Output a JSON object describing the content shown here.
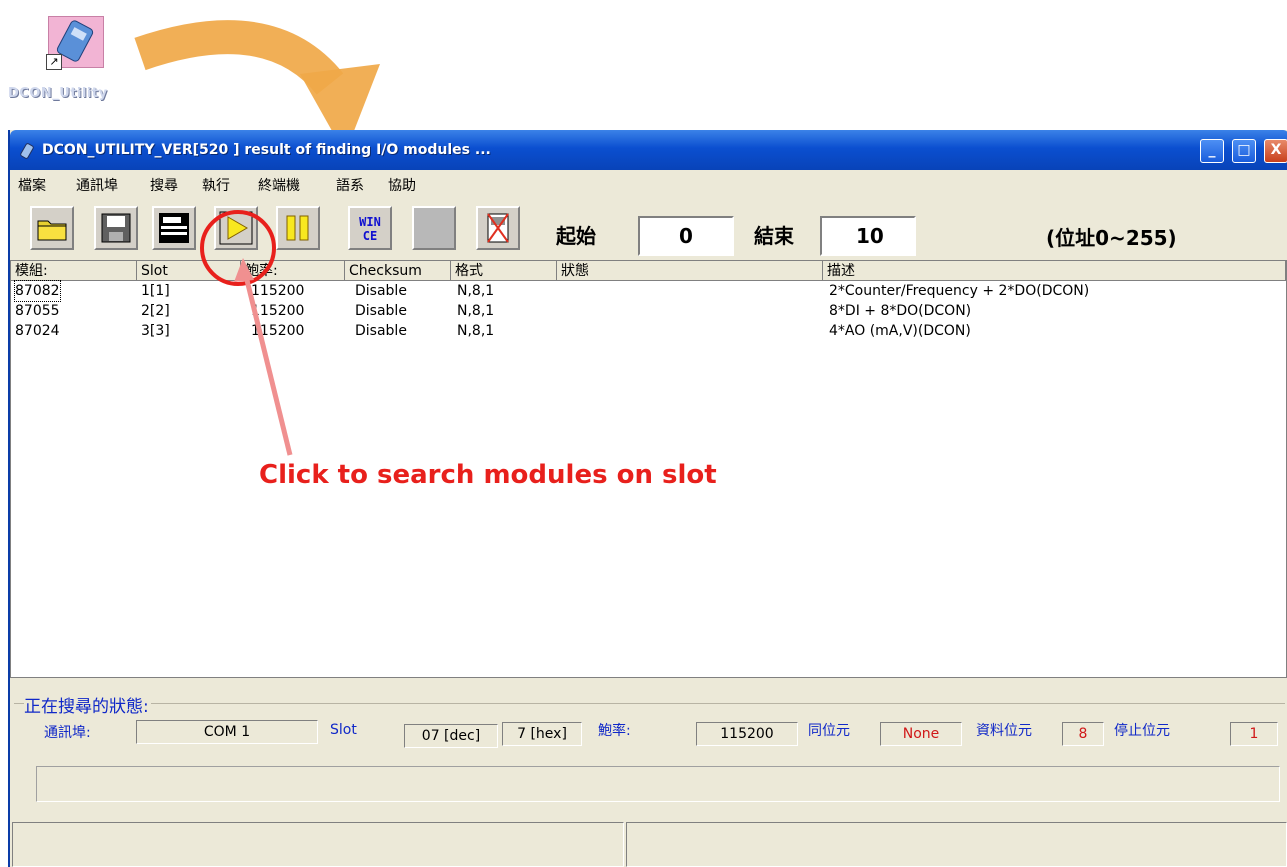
{
  "desktop": {
    "shortcut_label": "DCON_Utility"
  },
  "window": {
    "title": "DCON_UTILITY_VER[520  ] result of finding I/O modules ...",
    "controls": {
      "minimize": "_",
      "maximize": "□",
      "close": "X"
    }
  },
  "menu": {
    "items": [
      "檔案",
      "通訊埠",
      "搜尋",
      "執行",
      "終端機",
      "語系",
      "協助"
    ]
  },
  "toolbar": {
    "buttons": [
      {
        "name": "open-folder",
        "icon": "folder-icon"
      },
      {
        "name": "save",
        "icon": "floppy-icon"
      },
      {
        "name": "print",
        "icon": "printer-icon"
      },
      {
        "name": "search-start",
        "icon": "play-icon"
      },
      {
        "name": "pause",
        "icon": "pause-icon"
      },
      {
        "name": "wince",
        "icon": "wince-icon",
        "text": "WIN CE"
      },
      {
        "name": "blank",
        "icon": "blank-icon"
      },
      {
        "name": "disconnect",
        "icon": "disconnect-icon"
      }
    ],
    "start_label": "起始",
    "start_value": "0",
    "end_label": "結束",
    "end_value": "10",
    "range_note": "(位址0~255)"
  },
  "table": {
    "columns": [
      "模組:",
      "Slot",
      "鮑率:",
      "Checksum",
      "格式",
      "狀態",
      "描述"
    ],
    "rows": [
      [
        "87082",
        "1[1]",
        "115200",
        "Disable",
        "N,8,1",
        "",
        "2*Counter/Frequency + 2*DO(DCON)"
      ],
      [
        "87055",
        "2[2]",
        "115200",
        "Disable",
        "N,8,1",
        "",
        "8*DI + 8*DO(DCON)"
      ],
      [
        "87024",
        "3[3]",
        "115200",
        "Disable",
        "N,8,1",
        "",
        "4*AO (mA,V)(DCON)"
      ]
    ]
  },
  "annotation": {
    "text": "Click to search modules on slot",
    "color": "#e8201c"
  },
  "status": {
    "group_title": "正在搜尋的狀態:",
    "port_label": "通訊埠:",
    "port_value": "COM 1",
    "slot_label": "Slot",
    "slot_dec": "07 [dec]",
    "slot_hex": "7 [hex]",
    "baud_label": "鮑率:",
    "baud_value": "115200",
    "parity_label": "同位元",
    "parity_value": "None",
    "databits_label": "資料位元",
    "databits_value": "8",
    "stopbits_label": "停止位元",
    "stopbits_value": "1",
    "progress_fraction": 0
  },
  "colors": {
    "titlebar": "#0b4fd0",
    "label_blue": "#1028c8",
    "value_red": "#d01818",
    "arrow_orange": "#f0a848"
  }
}
